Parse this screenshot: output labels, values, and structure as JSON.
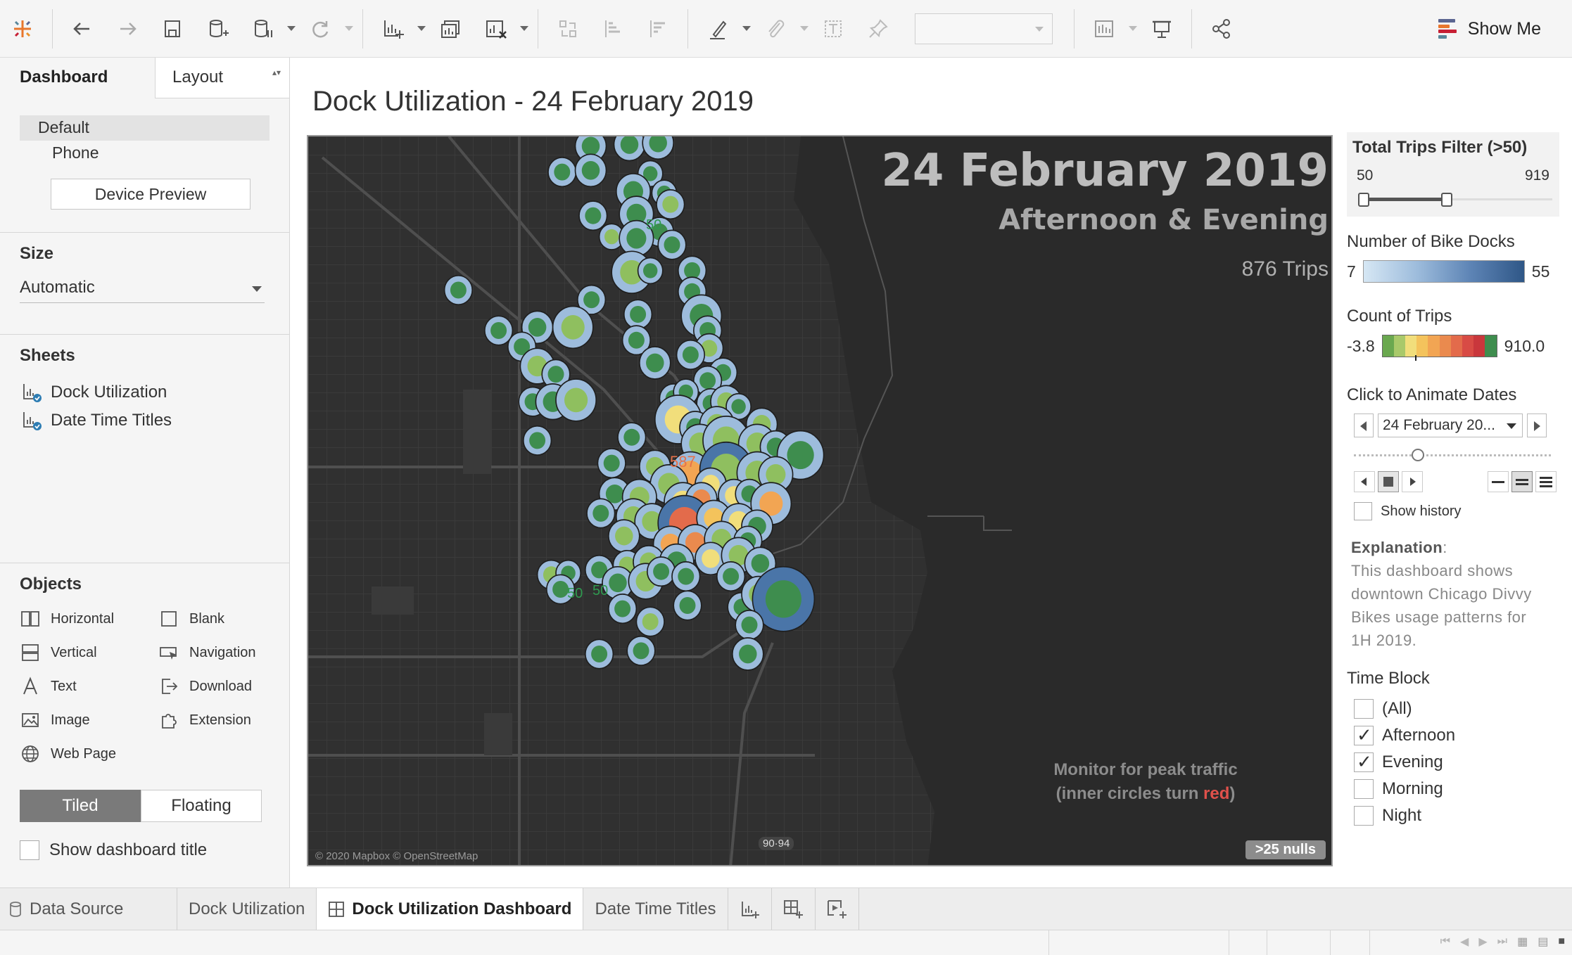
{
  "toolbar": {
    "show_me_label": "Show Me"
  },
  "left_panel": {
    "tabs": {
      "dashboard": "Dashboard",
      "layout": "Layout"
    },
    "devices": {
      "default": "Default",
      "phone": "Phone",
      "preview_button": "Device Preview"
    },
    "size": {
      "title": "Size",
      "value": "Automatic"
    },
    "sheets": {
      "title": "Sheets",
      "items": [
        "Dock Utilization",
        "Date Time Titles"
      ]
    },
    "objects": {
      "title": "Objects",
      "items": [
        "Horizontal",
        "Blank",
        "Vertical",
        "Navigation",
        "Text",
        "Download",
        "Image",
        "Extension",
        "Web Page"
      ]
    },
    "tiled_label": "Tiled",
    "floating_label": "Floating",
    "show_title_label": "Show dashboard title"
  },
  "dashboard": {
    "title": "Dock Utilization - 24 February 2019",
    "map": {
      "date": "24 February 2019",
      "time_block": "Afternoon & Evening",
      "trips": "876 Trips",
      "note_line1": "Monitor for peak traffic",
      "note_line2_prefix": "(inner circles turn ",
      "note_line2_red": "red",
      "note_line2_suffix": ")",
      "copyright": "© 2020 Mapbox © OpenStreetMap",
      "nulls": ">25 nulls",
      "highway_shield": "90·94",
      "marker_labels": [
        "50",
        "50",
        "50",
        "587"
      ]
    }
  },
  "legends": {
    "trips_filter": {
      "title": "Total Trips Filter (>50)",
      "min": "50",
      "max": "919",
      "low_value": 50,
      "high_value": 919,
      "range_min": 50,
      "range_max": 919
    },
    "bike_docks": {
      "title": "Number of Bike Docks",
      "min": "7",
      "max": "55",
      "colors": [
        "#d6e7f4",
        "#9dbcdc",
        "#5d84b5",
        "#2f5787"
      ]
    },
    "count_trips": {
      "title": "Count of Trips",
      "min": "-3.8",
      "max": "910.0",
      "colors": [
        "#3e8d4e",
        "#6aa84f",
        "#a9c96a",
        "#f1de7b",
        "#f4c35c",
        "#f2a553",
        "#ea8a4e",
        "#e36b4b",
        "#d84b45",
        "#c9373c"
      ]
    },
    "animate": {
      "title": "Click to Animate Dates",
      "value": "24 February 20...",
      "show_history": "Show history"
    },
    "explanation": {
      "label": "Explanation",
      "text": "This dashboard shows downtown Chicago Divvy Bikes usage patterns for 1H 2019."
    },
    "time_block": {
      "title": "Time Block",
      "options": [
        {
          "label": "(All)",
          "checked": false
        },
        {
          "label": "Afternoon",
          "checked": true
        },
        {
          "label": "Evening",
          "checked": true
        },
        {
          "label": "Morning",
          "checked": false
        },
        {
          "label": "Night",
          "checked": false
        }
      ]
    }
  },
  "bottom_tabs": {
    "data_source": "Data Source",
    "sheet1": "Dock Utilization",
    "dashboard": "Dock Utilization Dashboard",
    "sheet2": "Date Time Titles"
  }
}
